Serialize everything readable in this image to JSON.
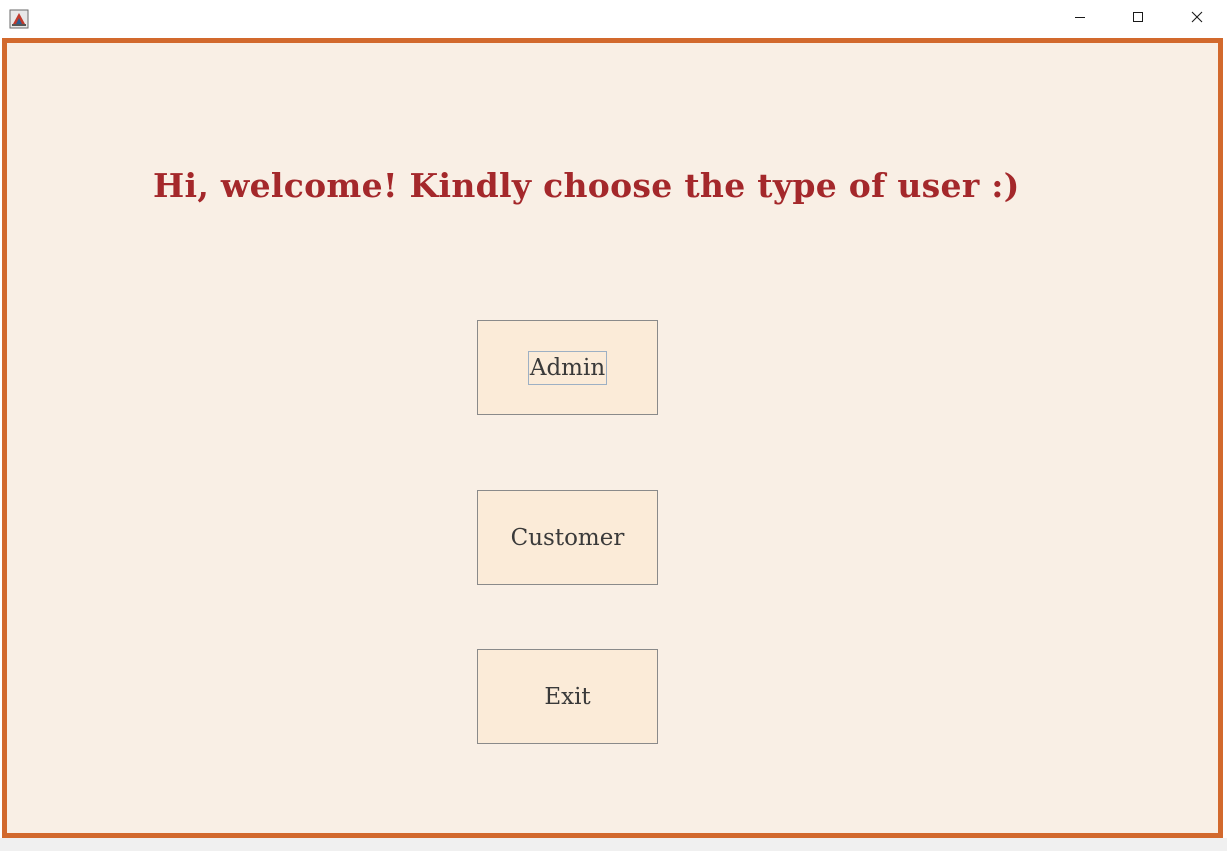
{
  "window": {
    "icons": {
      "app": "java-app-icon",
      "minimize": "minimize-icon",
      "maximize": "maximize-icon",
      "close": "close-icon"
    }
  },
  "main": {
    "headline": "Hi, welcome! Kindly choose the type of user :)",
    "buttons": {
      "admin": "Admin",
      "customer": "Customer",
      "exit": "Exit"
    },
    "focused_button": "admin"
  },
  "colors": {
    "frame_border": "#d2692d",
    "background": "#f9efe5",
    "headline": "#a4282b",
    "button_bg": "#fbebd8"
  }
}
